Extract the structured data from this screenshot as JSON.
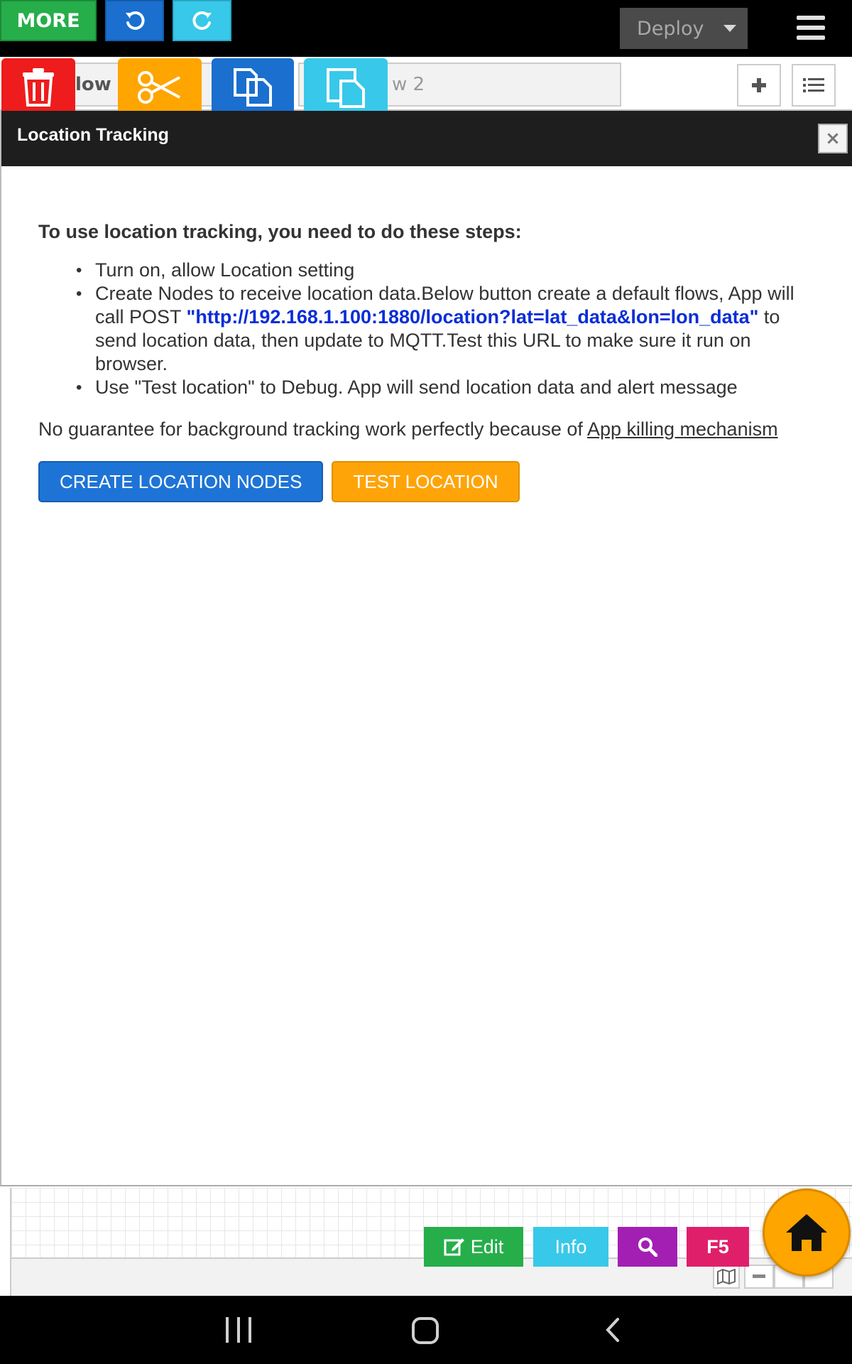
{
  "toolbar": {
    "more_label": "MORE",
    "deploy_label": "Deploy"
  },
  "tabs": [
    {
      "label": "low 1"
    },
    {
      "label": "w 2"
    }
  ],
  "dialog": {
    "title": "Location Tracking",
    "close_label": "×",
    "heading": "To use location tracking, you need to do these steps:",
    "steps": {
      "step1": "Turn on, allow Location setting",
      "step2_before": "Create Nodes to receive location data.Below button create a default flows, App will call POST ",
      "step2_url": "\"http://192.168.1.100:1880/location?lat=lat_data&lon=lon_data\"",
      "step2_after": " to send location data, then update to MQTT.Test this URL to make sure it run on browser.",
      "step3": "Use \"Test location\" to Debug. App will send location data and alert message"
    },
    "guarantee_text": "No guarantee for background tracking work perfectly because of ",
    "guarantee_link": "App killing mechanism",
    "create_button": "CREATE LOCATION NODES",
    "test_button": "TEST LOCATION"
  },
  "footer": {
    "edit_label": "Edit",
    "info_label": "Info",
    "f5_label": "F5"
  },
  "colors": {
    "more_green": "#26ae4a",
    "undo_blue": "#1a6fcf",
    "redo_cyan": "#38c8ea",
    "trash_red": "#ee1c1c",
    "cut_orange": "#ffa500",
    "url_blue": "#0b2dd8",
    "search_purple": "#a31fb3",
    "f5_pink": "#e01f6b"
  },
  "icons": [
    "undo-icon",
    "redo-icon",
    "hamburger-icon",
    "trash-icon",
    "scissors-icon",
    "copy-icon",
    "paste-icon",
    "plus-icon",
    "list-icon",
    "close-icon",
    "edit-icon",
    "search-icon",
    "home-icon",
    "map-icon",
    "minus-icon",
    "nav-recents-icon",
    "nav-home-icon",
    "nav-back-icon"
  ]
}
